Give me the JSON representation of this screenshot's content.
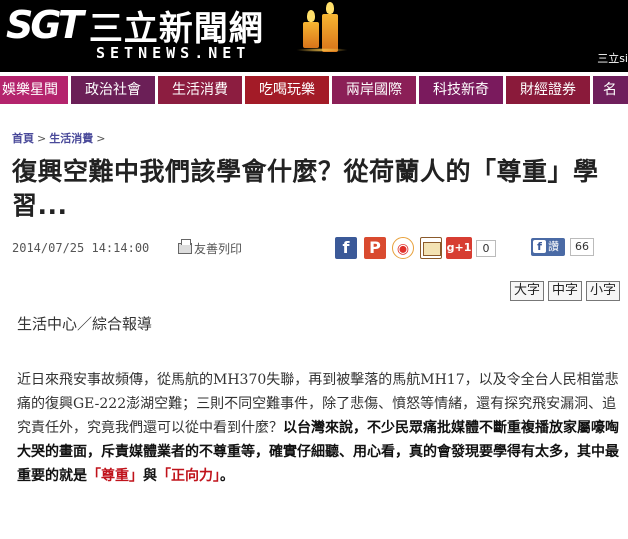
{
  "header": {
    "logo_mark": "SGT",
    "logo_cn": "三立新聞網",
    "logo_en": "SETNEWS.NET",
    "top_right_text": "三立si"
  },
  "nav": {
    "items": [
      {
        "label": "娛樂星聞",
        "color": "#b4246d"
      },
      {
        "label": "政治社會",
        "color": "#6b1f57"
      },
      {
        "label": "生活消費",
        "color": "#8c1d40"
      },
      {
        "label": "吃喝玩樂",
        "color": "#a31b27"
      },
      {
        "label": "兩岸國際",
        "color": "#8b1f57"
      },
      {
        "label": "科技新奇",
        "color": "#7a1a5d"
      },
      {
        "label": "財經證券",
        "color": "#8a1a3a"
      },
      {
        "label": "名",
        "color": "#6f1f5c"
      }
    ]
  },
  "breadcrumb": {
    "home": "首頁",
    "section": "生活消費",
    "sep": ">"
  },
  "article": {
    "title": "復興空難中我們該學會什麼？從荷蘭人的「尊重」學習...",
    "date": "2014/07/25 14:14:00",
    "print_label": "友善列印",
    "gplus_label": "g+1",
    "gplus_count": "0",
    "fb_share_label": "讚",
    "fb_count": "66",
    "font_sizes": [
      "大字",
      "中字",
      "小字"
    ],
    "byline": "生活中心／綜合報導",
    "para_plain": "近日來飛安事故頻傳，從馬航的MH370失聯，再到被擊落的馬航MH17，以及令全台人民相當悲痛的復興GE-222澎湖空難；三則不同空難事件，除了悲傷、憤怒等情緒，還有探究飛安漏洞、追究責任外，究竟我們還可以從中看到什麼？",
    "para_bold": "以台灣來說，不少民眾痛批媒體不斷重複播放家屬嚎啕大哭的畫面，斥責媒體業者的不尊重等，確實仔細聽、用心看，真的會發現要學得有太多，其中最重要的就是",
    "highlight_1": "「尊重」",
    "joiner": "與",
    "highlight_2": "「正向力」",
    "end_mark": "。"
  },
  "icons": {
    "facebook": "facebook-icon",
    "plurk": "plurk-icon",
    "weibo": "weibo-icon",
    "mail": "mail-icon",
    "print": "printer-icon"
  }
}
